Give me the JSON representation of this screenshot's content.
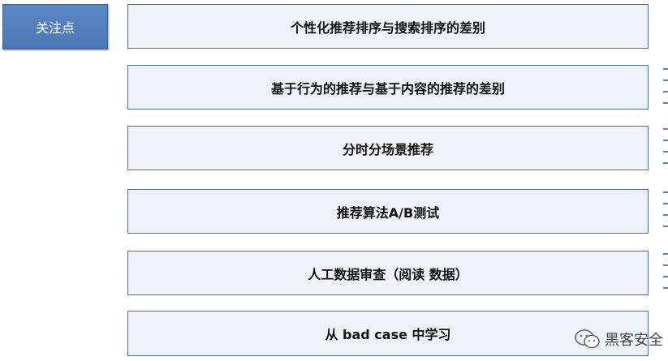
{
  "header": {
    "label": "关注点"
  },
  "items": [
    {
      "label": "个性化推荐排序与搜索排序的差别"
    },
    {
      "label": "基于行为的推荐与基于内容的推荐的差别"
    },
    {
      "label": "分时分场景推荐"
    },
    {
      "label": "推荐算法A/B测试"
    },
    {
      "label": "人工数据审查（阅读 数据）"
    },
    {
      "label": "从 bad case 中学习"
    }
  ],
  "watermark": {
    "text": "黑客安全",
    "icon": "wechat-icon"
  },
  "colors": {
    "header_fill": "#4f7fbf",
    "item_fill": "#eef3fa",
    "item_border": "#4a6e9e"
  }
}
